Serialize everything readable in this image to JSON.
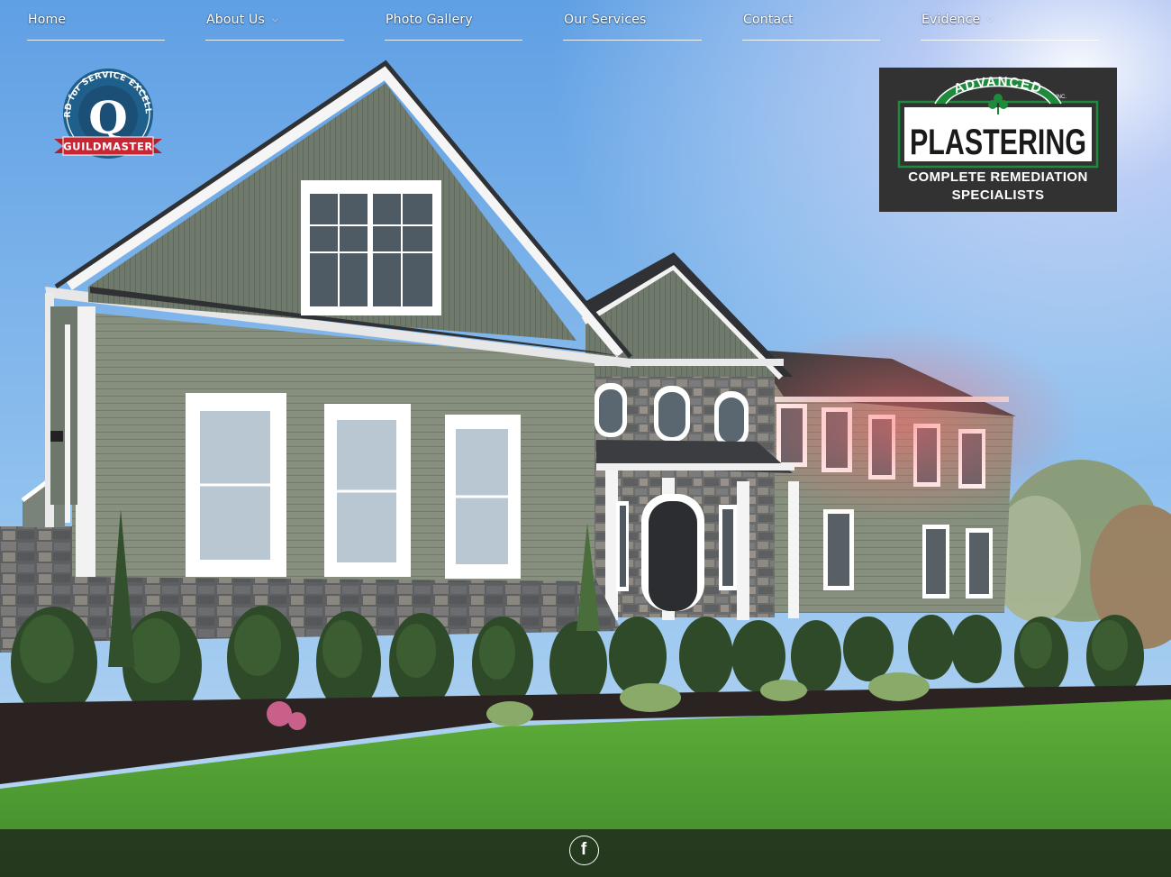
{
  "nav": {
    "items": [
      {
        "label": "Home",
        "has_dropdown": false
      },
      {
        "label": "About Us",
        "has_dropdown": true
      },
      {
        "label": "Photo Gallery",
        "has_dropdown": false
      },
      {
        "label": "Our Services",
        "has_dropdown": false
      },
      {
        "label": "Contact",
        "has_dropdown": false
      },
      {
        "label": "Evidence",
        "has_dropdown": true
      }
    ],
    "dropdown_icon": "chevron-down-icon"
  },
  "badge": {
    "arc_text": "AWARD for SERVICE EXCELLENCE",
    "letter": "Q",
    "ribbon": "GUILDMASTER"
  },
  "logo": {
    "brand_top": "ADVANCED",
    "brand_suffix": "INC.",
    "brand_main": "PLASTERING",
    "slogan_line1": "COMPLETE REMEDIATION",
    "slogan_line2": "SPECIALISTS",
    "accent_color": "#1e8a3c"
  },
  "footer": {
    "social_icon": "facebook-icon",
    "social_glyph": "f"
  }
}
